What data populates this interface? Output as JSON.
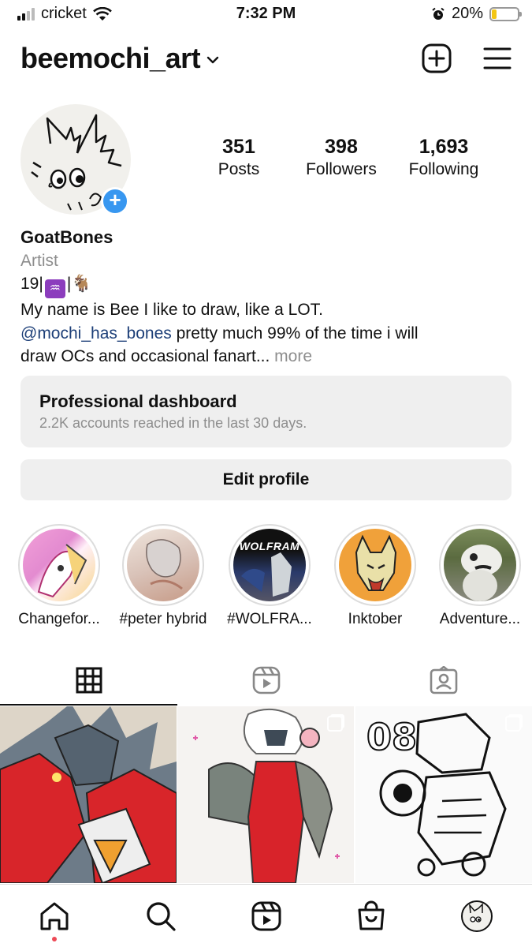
{
  "status_bar": {
    "carrier": "cricket",
    "time": "7:32 PM",
    "battery_percent": "20%",
    "battery_level": 0.2,
    "icons": [
      "signal-icon",
      "wifi-icon",
      "alarm-icon",
      "battery-icon"
    ]
  },
  "header": {
    "username": "beemochi_art",
    "icons": [
      "chevron-down-icon",
      "new-post-icon",
      "menu-icon"
    ]
  },
  "profile": {
    "stats": [
      {
        "value": "351",
        "label": "Posts"
      },
      {
        "value": "398",
        "label": "Followers"
      },
      {
        "value": "1,693",
        "label": "Following"
      }
    ],
    "display_name": "GoatBones",
    "category": "Artist",
    "bio_line1_prefix": "19|",
    "bio_aquarius": "♒",
    "bio_line1_suffix": "|🐐",
    "bio_line2": "My name is Bee I like to draw, like a LOT.",
    "bio_mention": "@mochi_has_bones",
    "bio_line3_rest": " pretty much 99% of the time i will",
    "bio_line4": "draw OCs and occasional fanart...",
    "bio_more": " more"
  },
  "dashboard": {
    "title": "Professional dashboard",
    "subtitle": "2.2K accounts reached in the last 30 days."
  },
  "edit_profile_label": "Edit profile",
  "highlights": [
    {
      "label": "Changefor...",
      "inner_text": ""
    },
    {
      "label": "#peter hybrid",
      "inner_text": ""
    },
    {
      "label": "#WOLFRA...",
      "inner_text": "WOLFRAM"
    },
    {
      "label": "Inktober",
      "inner_text": ""
    },
    {
      "label": "Adventure...",
      "inner_text": ""
    }
  ],
  "tabs": [
    "grid-icon",
    "reels-icon",
    "tagged-icon"
  ],
  "grid_posts": [
    {
      "text": ""
    },
    {
      "text": ""
    },
    {
      "text": "08"
    }
  ],
  "bottom_nav": [
    "home-icon",
    "search-icon",
    "reels-icon",
    "shop-icon",
    "profile-avatar"
  ],
  "colors": {
    "accent_blue": "#3897f0",
    "mention": "#1d3f78",
    "secondary_text": "#8e8e8e",
    "button_bg": "#efefef",
    "notification_dot": "#ed4956",
    "battery": "#f3c614"
  }
}
